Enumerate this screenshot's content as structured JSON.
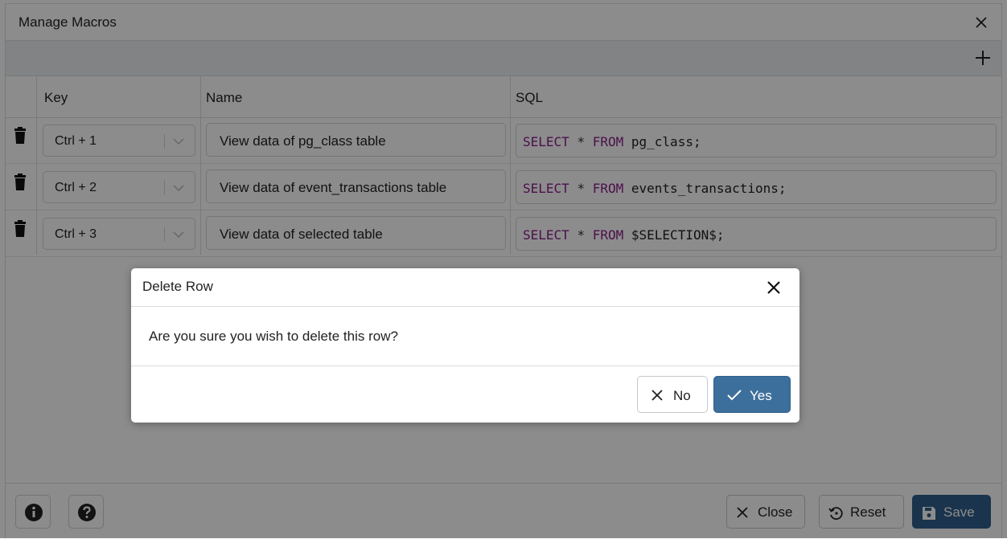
{
  "window": {
    "title": "Manage Macros",
    "close_icon": "close-icon",
    "add_icon": "plus-icon"
  },
  "table": {
    "headers": {
      "key": "Key",
      "name": "Name",
      "sql": "SQL"
    },
    "rows": [
      {
        "key": "Ctrl + 1",
        "name": "View data of pg_class table",
        "sql_kw1": "SELECT",
        "sql_op": "*",
        "sql_kw2": "FROM",
        "sql_target": "pg_class;"
      },
      {
        "key": "Ctrl + 2",
        "name": "View data of event_transactions table",
        "sql_kw1": "SELECT",
        "sql_op": "*",
        "sql_kw2": "FROM",
        "sql_target": "events_transactions;"
      },
      {
        "key": "Ctrl + 3",
        "name": "View data of selected table",
        "sql_kw1": "SELECT",
        "sql_op": "*",
        "sql_kw2": "FROM",
        "sql_target": "$SELECTION$;"
      }
    ]
  },
  "footer": {
    "close_label": "Close",
    "reset_label": "Reset",
    "save_label": "Save"
  },
  "dialog": {
    "title": "Delete Row",
    "message": "Are you sure you wish to delete this row?",
    "no_label": "No",
    "yes_label": "Yes"
  },
  "colors": {
    "primary": "#3d6f9c",
    "sql_keyword": "#8b1e8b",
    "overlay": "rgba(0,0,0,0.45)"
  }
}
